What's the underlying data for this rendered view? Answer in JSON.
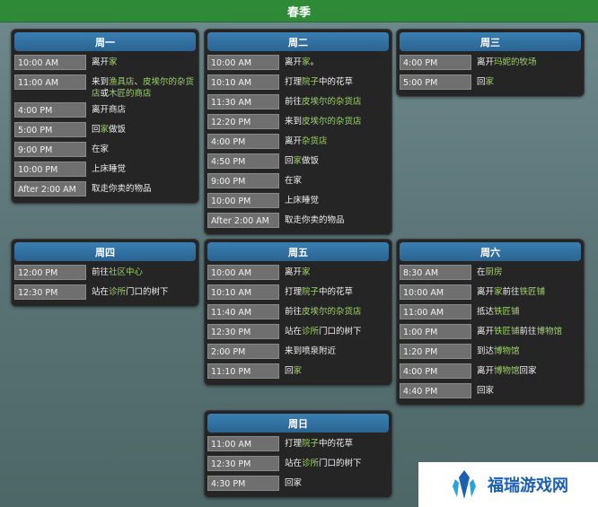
{
  "season": "春季",
  "days": [
    {
      "id": "mon",
      "title": "周一",
      "events": [
        {
          "time": "10:00 AM",
          "parts": [
            [
              "离开",
              ""
            ],
            [
              "家",
              "hl"
            ]
          ]
        },
        {
          "time": "11:00 AM",
          "parts": [
            [
              "来到",
              ""
            ],
            [
              "渔具店",
              "hl"
            ],
            [
              "、",
              ""
            ],
            [
              "皮埃尔的杂货店",
              "hl"
            ],
            [
              "或",
              ""
            ],
            [
              "木匠的商店",
              "hl"
            ]
          ]
        },
        {
          "time": "4:00 PM",
          "parts": [
            [
              "离开商店",
              ""
            ]
          ]
        },
        {
          "time": "5:00 PM",
          "parts": [
            [
              "回",
              ""
            ],
            [
              "家",
              "hl"
            ],
            [
              "做饭",
              ""
            ]
          ]
        },
        {
          "time": "9:00 PM",
          "parts": [
            [
              "在家",
              ""
            ]
          ]
        },
        {
          "time": "10:00 PM",
          "parts": [
            [
              "上床睡觉",
              ""
            ]
          ]
        },
        {
          "time": "After 2:00 AM",
          "parts": [
            [
              "取走你卖的物品",
              ""
            ]
          ]
        }
      ]
    },
    {
      "id": "tue",
      "title": "周二",
      "events": [
        {
          "time": "10:00 AM",
          "parts": [
            [
              "离开",
              ""
            ],
            [
              "家",
              "hl"
            ],
            [
              "。",
              ""
            ]
          ]
        },
        {
          "time": "10:10 AM",
          "parts": [
            [
              "打理",
              ""
            ],
            [
              "院子",
              "hl"
            ],
            [
              "中的花草",
              ""
            ]
          ]
        },
        {
          "time": "11:30 AM",
          "parts": [
            [
              "前往",
              ""
            ],
            [
              "皮埃尔的杂货店",
              "hl"
            ]
          ]
        },
        {
          "time": "12:20 PM",
          "parts": [
            [
              "来到",
              ""
            ],
            [
              "皮埃尔的杂货店",
              "hl"
            ]
          ]
        },
        {
          "time": "4:00 PM",
          "parts": [
            [
              "离开",
              ""
            ],
            [
              "杂货店",
              "hl"
            ]
          ]
        },
        {
          "time": "4:50 PM",
          "parts": [
            [
              "回",
              ""
            ],
            [
              "家",
              "hl"
            ],
            [
              "做饭",
              ""
            ]
          ]
        },
        {
          "time": "9:00 PM",
          "parts": [
            [
              "在家",
              ""
            ]
          ]
        },
        {
          "time": "10:00 PM",
          "parts": [
            [
              "上床睡觉",
              ""
            ]
          ]
        },
        {
          "time": "After 2:00 AM",
          "parts": [
            [
              "取走你卖的物品",
              ""
            ]
          ]
        }
      ]
    },
    {
      "id": "wed",
      "title": "周三",
      "events": [
        {
          "time": "4:00 PM",
          "parts": [
            [
              "离开",
              ""
            ],
            [
              "玛妮的牧场",
              "hl"
            ]
          ]
        },
        {
          "time": "5:00 PM",
          "parts": [
            [
              "回",
              ""
            ],
            [
              "家",
              "hl"
            ]
          ]
        }
      ]
    },
    {
      "id": "thu",
      "title": "周四",
      "events": [
        {
          "time": "12:00 PM",
          "parts": [
            [
              "前往",
              ""
            ],
            [
              "社区中心",
              "hl"
            ]
          ]
        },
        {
          "time": "12:30 PM",
          "parts": [
            [
              "站在",
              ""
            ],
            [
              "诊所",
              "hl"
            ],
            [
              "门口的树下",
              ""
            ]
          ]
        }
      ]
    },
    {
      "id": "fri",
      "title": "周五",
      "events": [
        {
          "time": "10:00 AM",
          "parts": [
            [
              "离开",
              ""
            ],
            [
              "家",
              "hl"
            ]
          ]
        },
        {
          "time": "10:10 AM",
          "parts": [
            [
              "打理",
              ""
            ],
            [
              "院子",
              "hl"
            ],
            [
              "中的花草",
              ""
            ]
          ]
        },
        {
          "time": "11:40 AM",
          "parts": [
            [
              "前往",
              ""
            ],
            [
              "皮埃尔的杂货店",
              "hl"
            ]
          ]
        },
        {
          "time": "12:30 PM",
          "parts": [
            [
              "站在",
              ""
            ],
            [
              "诊所",
              "hl"
            ],
            [
              "门口的树下",
              ""
            ]
          ]
        },
        {
          "time": "2:00 PM",
          "parts": [
            [
              "来到喷泉附近",
              ""
            ]
          ]
        },
        {
          "time": "11:10 PM",
          "parts": [
            [
              "回",
              ""
            ],
            [
              "家",
              "hl"
            ]
          ]
        }
      ]
    },
    {
      "id": "sat",
      "title": "周六",
      "events": [
        {
          "time": "8:30 AM",
          "parts": [
            [
              "在",
              ""
            ],
            [
              "厨房",
              "hl"
            ]
          ]
        },
        {
          "time": "10:00 AM",
          "parts": [
            [
              "离开",
              ""
            ],
            [
              "家",
              "hl"
            ],
            [
              "前往",
              ""
            ],
            [
              "铁匠铺",
              "hl"
            ]
          ]
        },
        {
          "time": "11:00 AM",
          "parts": [
            [
              "抵达",
              ""
            ],
            [
              "铁匠铺",
              "hl"
            ]
          ]
        },
        {
          "time": "1:00 PM",
          "parts": [
            [
              "离开",
              ""
            ],
            [
              "铁匠铺",
              "hl"
            ],
            [
              "前往",
              ""
            ],
            [
              "博物馆",
              "hl"
            ]
          ]
        },
        {
          "time": "1:20 PM",
          "parts": [
            [
              "到达",
              ""
            ],
            [
              "博物馆",
              "hl"
            ]
          ]
        },
        {
          "time": "4:00 PM",
          "parts": [
            [
              "离开",
              ""
            ],
            [
              "博物馆",
              "hl"
            ],
            [
              "回家",
              ""
            ]
          ]
        },
        {
          "time": "4:40 PM",
          "parts": [
            [
              "回家",
              ""
            ]
          ]
        }
      ]
    },
    {
      "id": "sun",
      "title": "周日",
      "events": [
        {
          "time": "11:00 AM",
          "parts": [
            [
              "打理",
              ""
            ],
            [
              "院子",
              "hl"
            ],
            [
              "中的花草",
              ""
            ]
          ]
        },
        {
          "time": "12:30 PM",
          "parts": [
            [
              "站在",
              ""
            ],
            [
              "诊所",
              "hl"
            ],
            [
              "门口的树下",
              ""
            ]
          ]
        },
        {
          "time": "4:30 PM",
          "parts": [
            [
              "回家",
              ""
            ]
          ]
        }
      ]
    }
  ],
  "watermark": {
    "text": "福瑞游戏网",
    "logo": "crystal-logo-icon",
    "color": "#1c5fb0"
  }
}
